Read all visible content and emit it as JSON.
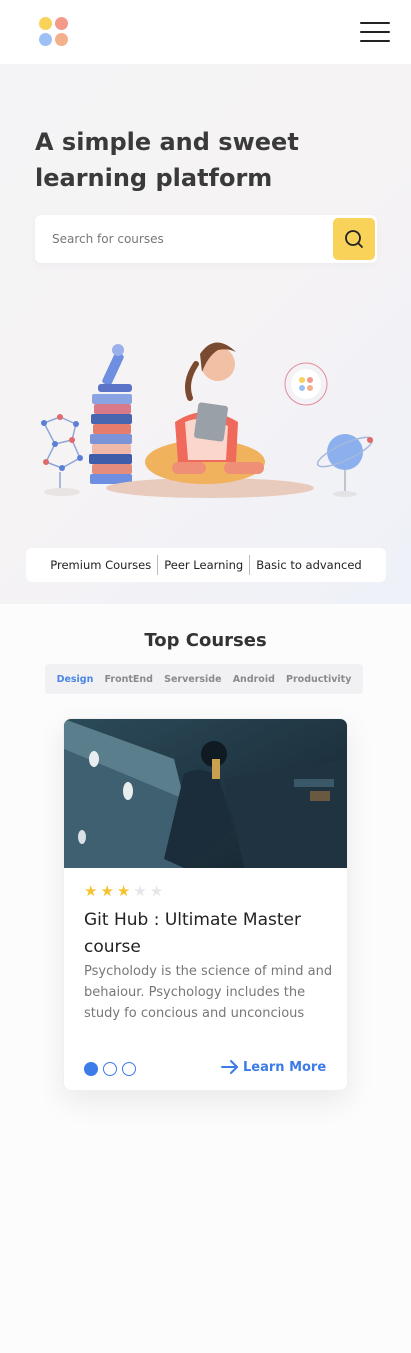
{
  "header": {
    "logo_colors": [
      "#f9d25a",
      "#f49a8a",
      "#9ec1f5",
      "#f4b08a"
    ],
    "menu_icon": "hamburger-icon"
  },
  "hero": {
    "title": "A simple and sweet learning platform",
    "search_placeholder": "Search for courses",
    "search_icon": "search-icon",
    "accent_color": "#f9d25a",
    "features": [
      "Premium Courses",
      "Peer Learning",
      "Basic to advanced"
    ]
  },
  "courses": {
    "title": "Top Courses",
    "tabs": [
      "Design",
      "FrontEnd",
      "Serverside",
      "Android",
      "Productivity"
    ],
    "active_tab": "Design",
    "card": {
      "rating": 3,
      "rating_max": 5,
      "title": "Git Hub : Ultimate Master course",
      "description": "Psycholody is the science of mind and behaiour. Psychology includes the study fo concious and unconcious",
      "cta": "Learn More",
      "cta_icon": "arrow-right-icon",
      "pagination_total": 3,
      "pagination_current": 1,
      "accent_color": "#3d7be8"
    }
  }
}
